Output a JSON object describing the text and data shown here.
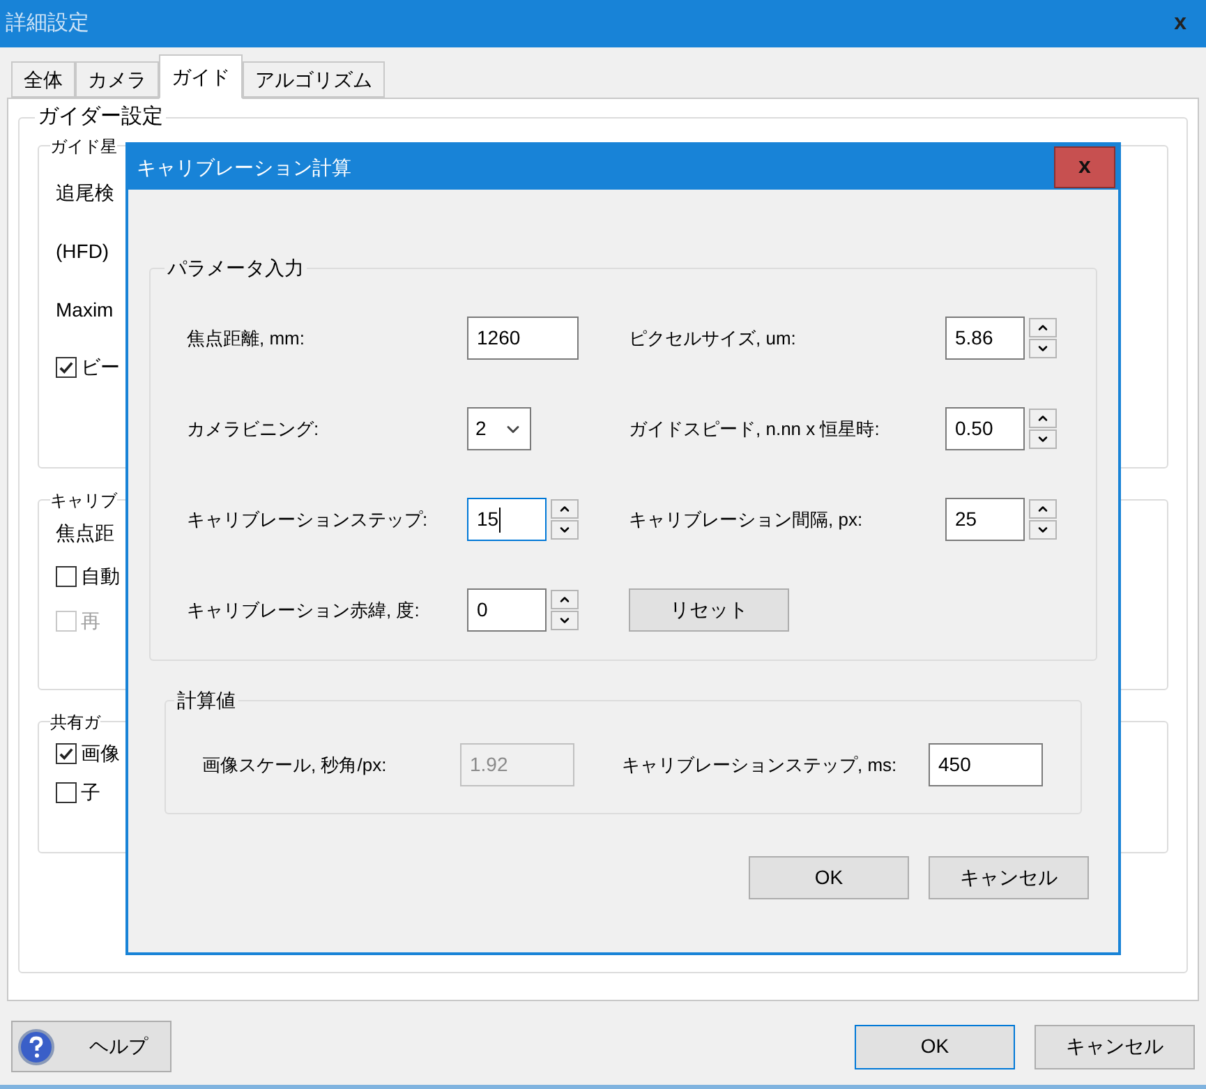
{
  "main_window": {
    "title": "詳細設定",
    "close": "x",
    "tabs": [
      {
        "label": "全体",
        "selected": false
      },
      {
        "label": "カメラ",
        "selected": false
      },
      {
        "label": "ガイド",
        "selected": true
      },
      {
        "label": "アルゴリズム",
        "selected": false
      }
    ],
    "group_title": "ガイダー設定",
    "sections": [
      {
        "title": "ガイド星",
        "items": [
          {
            "kind": "label",
            "text": "追尾検"
          },
          {
            "kind": "label",
            "text": "(HFD)"
          },
          {
            "kind": "label",
            "text": "Maxim"
          },
          {
            "kind": "checkbox",
            "text": "ビー",
            "checked": true,
            "disabled": false
          }
        ]
      },
      {
        "title": "キャリブ",
        "items": [
          {
            "kind": "label",
            "text": "焦点距"
          },
          {
            "kind": "checkbox",
            "text": "自動",
            "checked": false,
            "disabled": false
          },
          {
            "kind": "checkbox",
            "text": "再",
            "checked": false,
            "disabled": true
          }
        ]
      },
      {
        "title": "共有ガ",
        "items": [
          {
            "kind": "checkbox",
            "text": "画像",
            "checked": true,
            "disabled": false
          },
          {
            "kind": "checkbox",
            "text": "子",
            "checked": false,
            "disabled": false
          }
        ]
      }
    ],
    "help_button": "ヘルプ",
    "buttons": [
      "OK",
      "キャンセル"
    ]
  },
  "dialog": {
    "title": "キャリブレーション計算",
    "close": "x",
    "input_group": {
      "title": "パラメータ入力",
      "left": [
        {
          "kind": "text",
          "label": "焦点距離, mm:",
          "value": "1260",
          "focused": false
        },
        {
          "kind": "select",
          "label": "カメラビニング:",
          "value": "2",
          "focused": false
        },
        {
          "kind": "spin",
          "label": "キャリブレーションステップ:",
          "value": "15",
          "focused": true
        },
        {
          "kind": "spin",
          "label": "キャリブレーション赤緯, 度:",
          "value": "0",
          "focused": false
        }
      ],
      "right": [
        {
          "kind": "spin",
          "label": "ピクセルサイズ, um:",
          "value": "5.86",
          "focused": false
        },
        {
          "kind": "spin",
          "label": "ガイドスピード, n.nn x 恒星時:",
          "value": "0.50",
          "focused": false
        },
        {
          "kind": "spin",
          "label": "キャリブレーション間隔, px:",
          "value": "25",
          "focused": false
        },
        {
          "kind": "button",
          "label": "リセット"
        }
      ]
    },
    "computed_group": {
      "title": "計算値",
      "fields": [
        {
          "label": "画像スケール, 秒角/px:",
          "value": "1.92",
          "disabled": true
        },
        {
          "label": "キャリブレーションステップ, ms:",
          "value": "450",
          "disabled": false
        }
      ]
    },
    "buttons": [
      "OK",
      "キャンセル"
    ]
  }
}
